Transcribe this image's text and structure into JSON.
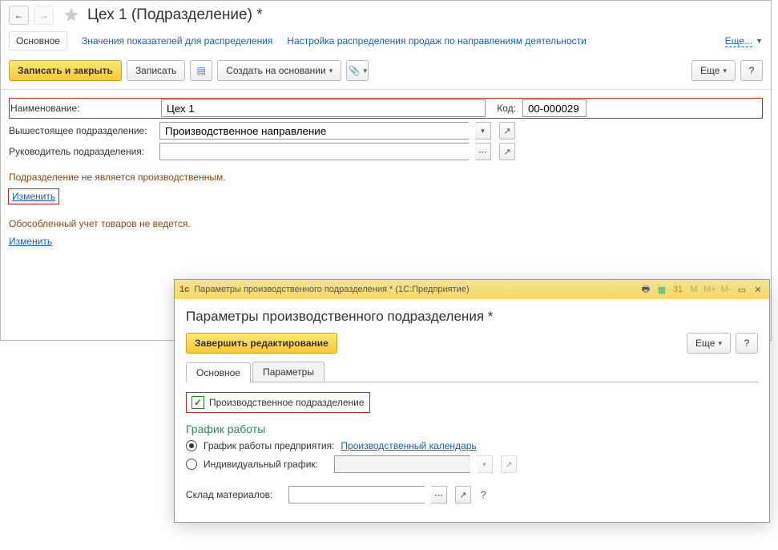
{
  "main": {
    "title": "Цех 1 (Подразделение) *",
    "tabs": {
      "current": "Основное",
      "link1": "Значения показателей для распределения",
      "link2": "Настройка распределения продаж по направлениям деятельности",
      "more": "Еще..."
    },
    "toolbar": {
      "save_close": "Записать и закрыть",
      "save": "Записать",
      "create_from": "Создать на основании",
      "more": "Еще",
      "help": "?"
    },
    "fields": {
      "name_label": "Наименование:",
      "name_value": "Цех 1",
      "code_label": "Код:",
      "code_value": "00-000029",
      "parent_label": "Вышестоящее подразделение:",
      "parent_value": "Производственное направление",
      "head_label": "Руководитель подразделения:",
      "head_value": ""
    },
    "status1": "Подразделение не является производственным.",
    "change": "Изменить",
    "status2": "Обособленный учет товаров не ведется."
  },
  "dialog": {
    "winTitle": "Параметры производственного подразделения * (1С:Предприятие)",
    "title": "Параметры производственного подразделения *",
    "finish": "Завершить редактирование",
    "more": "Еще",
    "help": "?",
    "tabs": {
      "t1": "Основное",
      "t2": "Параметры"
    },
    "checkbox": "Производственное подразделение",
    "group": "График работы",
    "radio1": "График работы предприятия:",
    "radio1_link": "Производственный календарь",
    "radio2": "Индивидуальный график:",
    "stock_label": "Склад материалов:"
  }
}
